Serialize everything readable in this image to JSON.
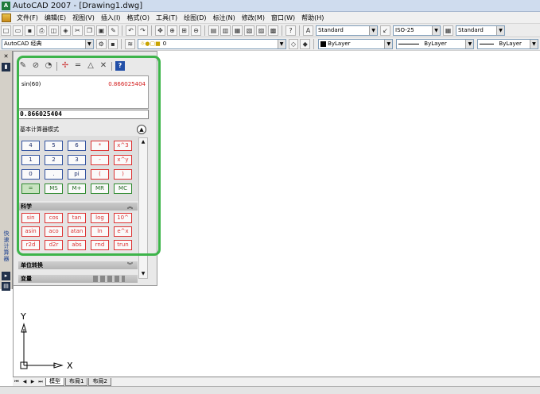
{
  "app": {
    "title": "AutoCAD 2007 - [Drawing1.dwg]",
    "logo": "A"
  },
  "menu": {
    "items": [
      "文件(F)",
      "编辑(E)",
      "视图(V)",
      "插入(I)",
      "格式(O)",
      "工具(T)",
      "绘图(D)",
      "标注(N)",
      "修改(M)",
      "窗口(W)",
      "帮助(H)"
    ]
  },
  "toolbar1": {
    "text_style": "Standard",
    "dim_style": "ISO-25",
    "table_style": "Standard"
  },
  "toolbar2": {
    "workspace": "AutoCAD 经典",
    "layer": "0",
    "color": "ByLayer",
    "linetype": "ByLayer",
    "lineweight": "ByLayer"
  },
  "calculator": {
    "history_expression": "sin(60)",
    "history_result": "0.866025404",
    "display_value": "0.866025404",
    "basic_section_title": "基本计算器模式",
    "basic_keys": [
      {
        "label": "4",
        "kind": "num"
      },
      {
        "label": "5",
        "kind": "num"
      },
      {
        "label": "6",
        "kind": "num"
      },
      {
        "label": "*",
        "kind": "op"
      },
      {
        "label": "x^3",
        "kind": "op"
      },
      {
        "label": "1",
        "kind": "num"
      },
      {
        "label": "2",
        "kind": "num"
      },
      {
        "label": "3",
        "kind": "num"
      },
      {
        "label": "-",
        "kind": "op"
      },
      {
        "label": "x^y",
        "kind": "op"
      },
      {
        "label": "0",
        "kind": "num"
      },
      {
        "label": ".",
        "kind": "num"
      },
      {
        "label": "pi",
        "kind": "num"
      },
      {
        "label": "(",
        "kind": "op"
      },
      {
        "label": ")",
        "kind": "op"
      },
      {
        "label": "=",
        "kind": "eq"
      },
      {
        "label": "MS",
        "kind": "mem"
      },
      {
        "label": "M+",
        "kind": "mem"
      },
      {
        "label": "MR",
        "kind": "mem"
      },
      {
        "label": "MC",
        "kind": "mem"
      }
    ],
    "scientific_title": "科学",
    "scientific_keys": [
      "sin",
      "cos",
      "tan",
      "log",
      "10^",
      "asin",
      "aco",
      "atan",
      "ln",
      "e^x",
      "r2d",
      "d2r",
      "abs",
      "rnd",
      "trun"
    ],
    "unit_title": "单位转换",
    "variables_title": "变量",
    "side_label": "快速计算器"
  },
  "ucs": {
    "x_label": "X",
    "y_label": "Y"
  },
  "tabs": {
    "model": "模型",
    "layout1": "布局1",
    "layout2": "布局2"
  }
}
